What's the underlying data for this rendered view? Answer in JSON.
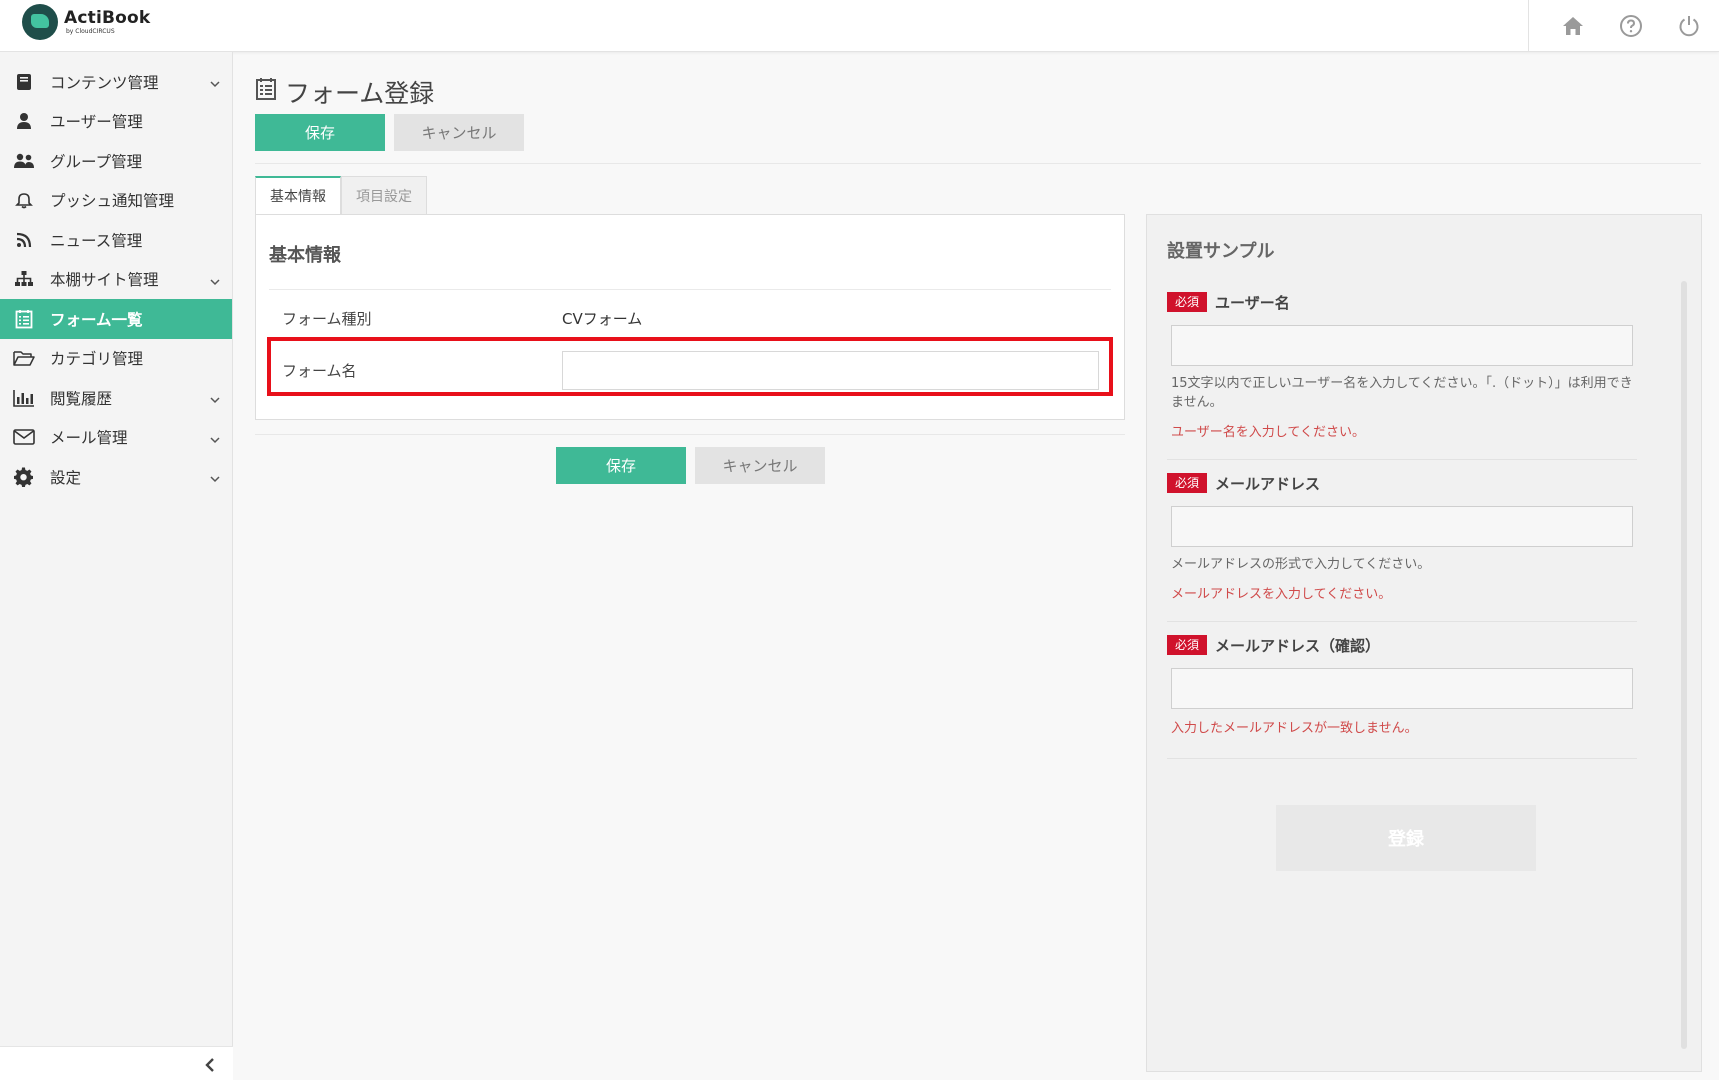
{
  "app": {
    "name": "ActiBook",
    "sub": "by CloudCIRCUS"
  },
  "header_icons": [
    "home-icon",
    "help-icon",
    "power-icon"
  ],
  "sidebar": {
    "items": [
      {
        "label": "コンテンツ管理",
        "icon": "book-icon",
        "has_chevron": true,
        "active": false
      },
      {
        "label": "ユーザー管理",
        "icon": "user-icon",
        "has_chevron": false,
        "active": false
      },
      {
        "label": "グループ管理",
        "icon": "users-icon",
        "has_chevron": false,
        "active": false
      },
      {
        "label": "プッシュ通知管理",
        "icon": "bell-icon",
        "has_chevron": false,
        "active": false
      },
      {
        "label": "ニュース管理",
        "icon": "rss-icon",
        "has_chevron": false,
        "active": false
      },
      {
        "label": "本棚サイト管理",
        "icon": "sitemap-icon",
        "has_chevron": true,
        "active": false
      },
      {
        "label": "フォーム一覧",
        "icon": "form-icon",
        "has_chevron": false,
        "active": true
      },
      {
        "label": "カテゴリ管理",
        "icon": "folder-icon",
        "has_chevron": false,
        "active": false
      },
      {
        "label": "閲覧履歴",
        "icon": "bar-chart-icon",
        "has_chevron": true,
        "active": false
      },
      {
        "label": "メール管理",
        "icon": "mail-icon",
        "has_chevron": true,
        "active": false
      },
      {
        "label": "設定",
        "icon": "gear-icon",
        "has_chevron": true,
        "active": false
      }
    ]
  },
  "page": {
    "title": "フォーム登録",
    "save_label": "保存",
    "cancel_label": "キャンセル"
  },
  "tabs": [
    {
      "label": "基本情報",
      "active": true
    },
    {
      "label": "項目設定",
      "active": false
    }
  ],
  "basic_info": {
    "heading": "基本情報",
    "form_type_label": "フォーム種別",
    "form_type_value": "CVフォーム",
    "form_name_label": "フォーム名",
    "form_name_value": ""
  },
  "sample": {
    "title": "設置サンプル",
    "required_badge": "必須",
    "fields": [
      {
        "label": "ユーザー名",
        "help": "15文字以内で正しいユーザー名を入力してください。「.（ドット）」は利用できません。",
        "error": "ユーザー名を入力してください。"
      },
      {
        "label": "メールアドレス",
        "help": "メールアドレスの形式で入力してください。",
        "error": "メールアドレスを入力してください。"
      },
      {
        "label": "メールアドレス（確認）",
        "help": "",
        "error": "入力したメールアドレスが一致しません。"
      }
    ],
    "submit_label": "登録"
  },
  "colors": {
    "accent": "#3fb996",
    "required": "#d0122c",
    "error_text": "#d04a4a",
    "highlight": "#e8101a"
  }
}
